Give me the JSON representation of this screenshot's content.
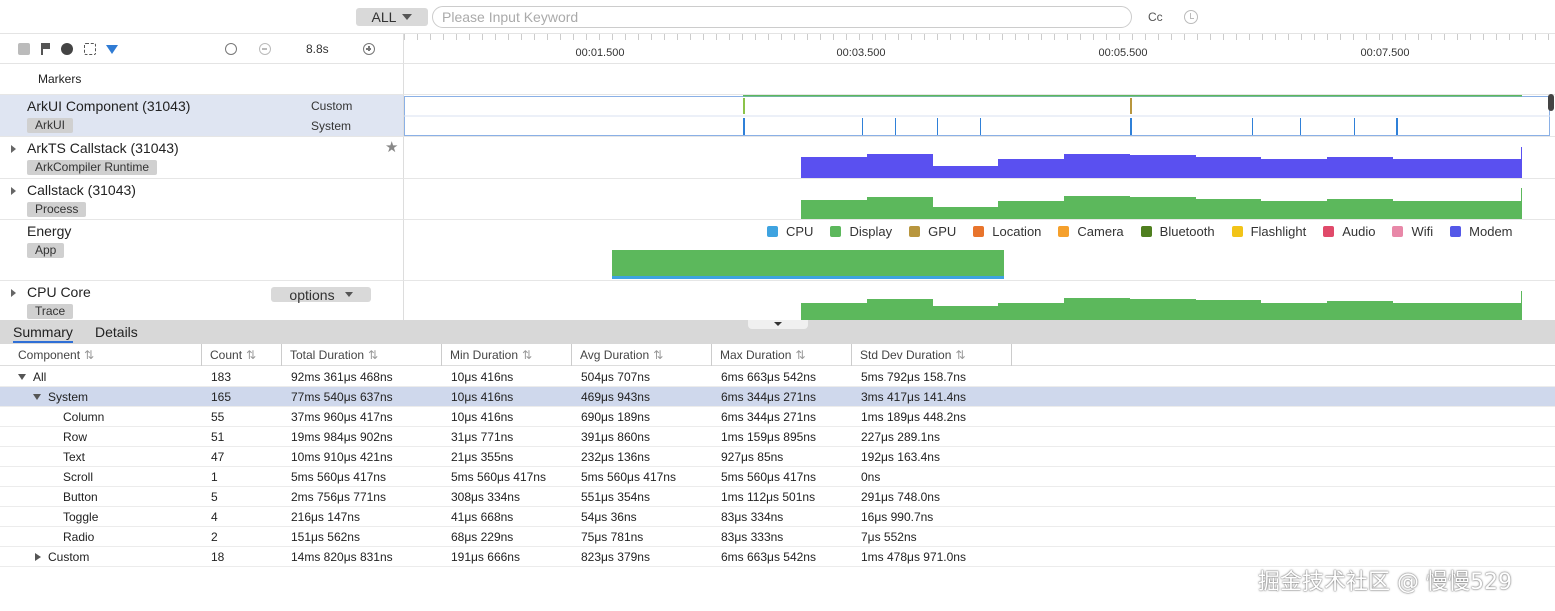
{
  "search": {
    "scope": "ALL",
    "placeholder": "Please Input Keyword",
    "case_toggle": "Cc"
  },
  "toolbar": {
    "zoom_level": "8.8s"
  },
  "ruler": {
    "ticks": [
      "00:01.500",
      "00:03.500",
      "00:05.500",
      "00:07.500"
    ]
  },
  "tracks": {
    "markers": {
      "title": "Markers"
    },
    "arkui": {
      "title": "ArkUI Component (31043)",
      "tag": "ArkUI",
      "sub_custom": "Custom",
      "sub_system": "System"
    },
    "arkts": {
      "title": "ArkTS Callstack (31043)",
      "tag": "ArkCompiler Runtime"
    },
    "callstack": {
      "title": "Callstack (31043)",
      "tag": "Process"
    },
    "energy": {
      "title": "Energy",
      "tag": "App"
    },
    "cpu": {
      "title": "CPU Core",
      "tag": "Trace",
      "options_label": "options"
    }
  },
  "energy_legend": [
    {
      "label": "CPU",
      "color": "#3ea3e0"
    },
    {
      "label": "Display",
      "color": "#5cb85c"
    },
    {
      "label": "GPU",
      "color": "#b8963e"
    },
    {
      "label": "Location",
      "color": "#e8742c"
    },
    {
      "label": "Camera",
      "color": "#f5a02c"
    },
    {
      "label": "Bluetooth",
      "color": "#4f7f1f"
    },
    {
      "label": "Flashlight",
      "color": "#f2c418"
    },
    {
      "label": "Audio",
      "color": "#e04a6a"
    },
    {
      "label": "Wifi",
      "color": "#e888a8"
    },
    {
      "label": "Modem",
      "color": "#5458e8"
    }
  ],
  "colors": {
    "flame_purple": "#5a50f0",
    "flame_green": "#5cb85c",
    "selection": "#cfd8ec",
    "accent_blue": "#2f6fd6"
  },
  "bottom_tabs": {
    "summary": "Summary",
    "details": "Details"
  },
  "summary_table": {
    "columns": [
      "Component",
      "Count",
      "Total Duration",
      "Min Duration",
      "Avg Duration",
      "Max Duration",
      "Std Dev Duration"
    ],
    "rows": [
      {
        "name": "All",
        "count": "183",
        "total": "92ms 361μs 468ns",
        "min": "10μs 416ns",
        "avg": "504μs 707ns",
        "max": "6ms 663μs 542ns",
        "std": "5ms 792μs 158.7ns"
      },
      {
        "name": "System",
        "count": "165",
        "total": "77ms 540μs 637ns",
        "min": "10μs 416ns",
        "avg": "469μs 943ns",
        "max": "6ms 344μs 271ns",
        "std": "3ms 417μs 141.4ns"
      },
      {
        "name": "Column",
        "count": "55",
        "total": "37ms 960μs 417ns",
        "min": "10μs 416ns",
        "avg": "690μs 189ns",
        "max": "6ms 344μs 271ns",
        "std": "1ms 189μs 448.2ns"
      },
      {
        "name": "Row",
        "count": "51",
        "total": "19ms 984μs 902ns",
        "min": "31μs 771ns",
        "avg": "391μs 860ns",
        "max": "1ms 159μs 895ns",
        "std": "227μs 289.1ns"
      },
      {
        "name": "Text",
        "count": "47",
        "total": "10ms 910μs 421ns",
        "min": "21μs 355ns",
        "avg": "232μs 136ns",
        "max": "927μs 85ns",
        "std": "192μs 163.4ns"
      },
      {
        "name": "Scroll",
        "count": "1",
        "total": "5ms 560μs 417ns",
        "min": "5ms 560μs 417ns",
        "avg": "5ms 560μs 417ns",
        "max": "5ms 560μs 417ns",
        "std": "0ns"
      },
      {
        "name": "Button",
        "count": "5",
        "total": "2ms 756μs 771ns",
        "min": "308μs 334ns",
        "avg": "551μs 354ns",
        "max": "1ms 112μs 501ns",
        "std": "291μs 748.0ns"
      },
      {
        "name": "Toggle",
        "count": "4",
        "total": "216μs 147ns",
        "min": "41μs 668ns",
        "avg": "54μs 36ns",
        "max": "83μs 334ns",
        "std": "16μs 990.7ns"
      },
      {
        "name": "Radio",
        "count": "2",
        "total": "151μs 562ns",
        "min": "68μs 229ns",
        "avg": "75μs 781ns",
        "max": "83μs 333ns",
        "std": "7μs 552ns"
      },
      {
        "name": "Custom",
        "count": "18",
        "total": "14ms 820μs 831ns",
        "min": "191μs 666ns",
        "avg": "823μs 379ns",
        "max": "6ms 663μs 542ns",
        "std": "1ms 478μs 971.0ns"
      }
    ]
  },
  "watermark": "掘金技术社区 @ 慢慢529"
}
